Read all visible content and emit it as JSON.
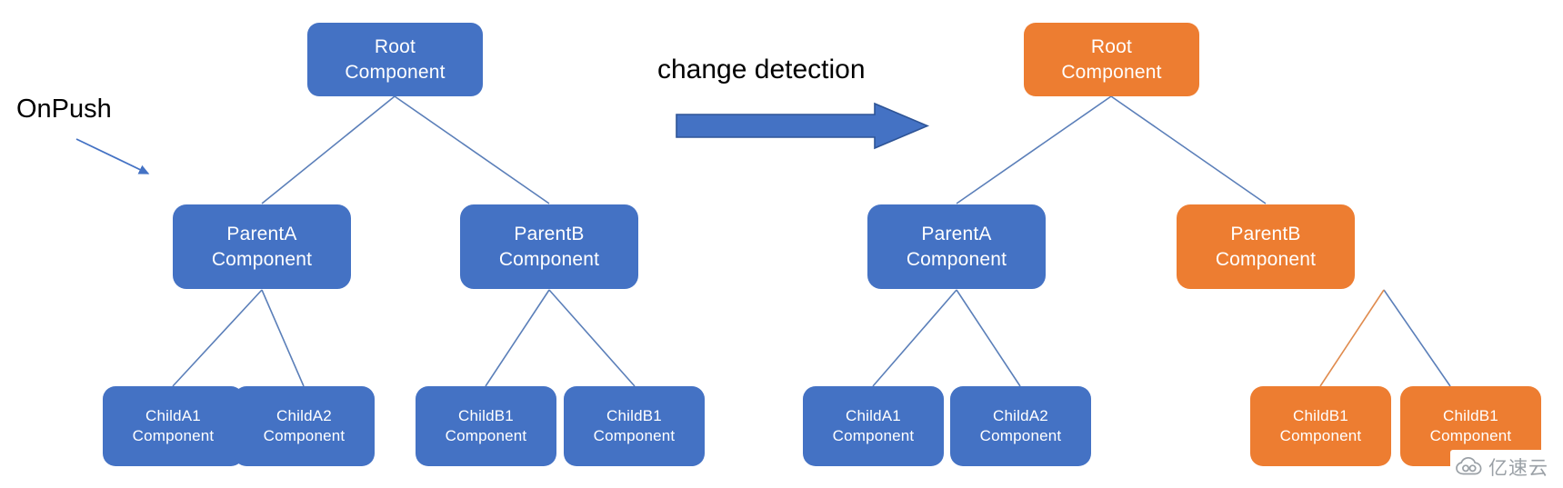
{
  "diagram": {
    "title": "Angular OnPush change detection component tree",
    "colors": {
      "blue": "#4472C4",
      "orange": "#ED7D31",
      "connector_blue": "#5B7FB9",
      "connector_orange": "#E08B4E",
      "background": "#FFFFFF",
      "label_text": "#000000",
      "node_text": "#FFFFFF"
    },
    "annotations": {
      "onpush_label": "OnPush",
      "change_detection_label": "change detection"
    },
    "left_tree": {
      "root": {
        "line1": "Root",
        "line2": "Component",
        "state": "blue"
      },
      "parents": [
        {
          "line1": "ParentA",
          "line2": "Component",
          "state": "blue"
        },
        {
          "line1": "ParentB",
          "line2": "Component",
          "state": "blue"
        }
      ],
      "children": [
        {
          "line1": "ChildA1",
          "line2": "Component",
          "state": "blue"
        },
        {
          "line1": "ChildA2",
          "line2": "Component",
          "state": "blue"
        },
        {
          "line1": "ChildB1",
          "line2": "Component",
          "state": "blue"
        },
        {
          "line1": "ChildB1",
          "line2": "Component",
          "state": "blue"
        }
      ]
    },
    "right_tree": {
      "root": {
        "line1": "Root",
        "line2": "Component",
        "state": "orange"
      },
      "parents": [
        {
          "line1": "ParentA",
          "line2": "Component",
          "state": "blue"
        },
        {
          "line1": "ParentB",
          "line2": "Component",
          "state": "orange"
        }
      ],
      "children": [
        {
          "line1": "ChildA1",
          "line2": "Component",
          "state": "blue"
        },
        {
          "line1": "ChildA2",
          "line2": "Component",
          "state": "blue"
        },
        {
          "line1": "ChildB1",
          "line2": "Component",
          "state": "orange"
        },
        {
          "line1": "ChildB1",
          "line2": "Component",
          "state": "orange"
        }
      ]
    },
    "watermark": {
      "text": "亿速云"
    }
  }
}
